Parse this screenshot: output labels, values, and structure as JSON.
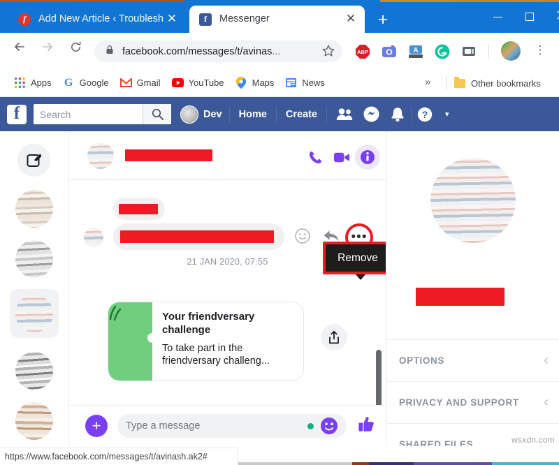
{
  "browser": {
    "tabs": [
      {
        "title": "Add New Article ‹ Troublesh",
        "favicon": "wordpress-icon",
        "active": false,
        "close_label": "✕"
      },
      {
        "title": "Messenger",
        "favicon": "facebook-icon",
        "active": true,
        "close_label": "✕"
      }
    ],
    "new_tab_label": "+",
    "window_controls": {
      "minimize": "−",
      "maximize": "□",
      "close": "✕"
    },
    "nav": {
      "back": "←",
      "forward": "→",
      "reload": "⟳"
    },
    "omnibox": {
      "url_visible": "facebook.com/messages/t/avinas",
      "url_ellipsis": "...",
      "lock_icon": "lock-icon",
      "star_icon": "bookmark-star-icon"
    },
    "extensions": [
      {
        "name": "adblock-plus-icon",
        "label": "ABP"
      },
      {
        "name": "screenshot-camera-icon",
        "label": ""
      },
      {
        "name": "translate-icon",
        "label": "A"
      },
      {
        "name": "grammarly-icon",
        "label": "G"
      },
      {
        "name": "clipboard-extension-icon",
        "label": ""
      }
    ],
    "profile_avatar": "user-avatar",
    "menu_icon": "chrome-menu-icon",
    "bookmarks": [
      {
        "label": "Apps",
        "icon": "apps-grid-icon"
      },
      {
        "label": "Google",
        "icon": "google-icon"
      },
      {
        "label": "Gmail",
        "icon": "gmail-icon"
      },
      {
        "label": "YouTube",
        "icon": "youtube-icon"
      },
      {
        "label": "Maps",
        "icon": "maps-pin-icon"
      },
      {
        "label": "News",
        "icon": "google-news-icon"
      }
    ],
    "bookmarks_overflow": "»",
    "other_bookmarks": "Other bookmarks",
    "status_url": "https://www.facebook.com/messages/t/avinash.ak2#"
  },
  "fb_header": {
    "logo": "f",
    "search_placeholder": "Search",
    "search_icon": "search-icon",
    "user_name": "Dev",
    "links": [
      {
        "label": "Home"
      },
      {
        "label": "Create"
      }
    ],
    "icons": [
      {
        "name": "friend-requests-icon"
      },
      {
        "name": "messenger-icon"
      },
      {
        "name": "notifications-bell-icon"
      },
      {
        "name": "help-question-icon"
      }
    ],
    "caret": "▾"
  },
  "messenger": {
    "rail": {
      "compose_icon": "compose-new-message-icon",
      "threads": [
        {
          "name": "thread-avatar-1",
          "selected": false
        },
        {
          "name": "thread-avatar-2",
          "selected": false
        },
        {
          "name": "thread-avatar-3",
          "selected": true
        },
        {
          "name": "thread-avatar-4",
          "selected": false
        },
        {
          "name": "thread-avatar-5",
          "selected": false
        }
      ]
    },
    "conversation": {
      "header": {
        "avatar": "contact-avatar",
        "name_redacted": true,
        "actions": [
          {
            "name": "voice-call-icon"
          },
          {
            "name": "video-call-icon"
          },
          {
            "name": "conversation-info-icon"
          }
        ]
      },
      "messages": [
        {
          "type": "text",
          "redacted": true,
          "size": "small"
        },
        {
          "type": "text",
          "redacted": true,
          "size": "large"
        }
      ],
      "hover_actions": [
        {
          "name": "react-emoji-icon"
        },
        {
          "name": "reply-arrow-icon"
        },
        {
          "name": "more-actions-icon",
          "highlighted": true
        }
      ],
      "tooltip": {
        "label": "Remove",
        "highlighted": true
      },
      "timestamp": "21 JAN 2020, 07:55",
      "card": {
        "title": "Your friendversary challenge",
        "subtitle": "To take part in the friendversary challeng...",
        "image": "friendversary-green-illustration",
        "share_icon": "share-icon"
      },
      "composer": {
        "plus_icon": "add-attachment-icon",
        "placeholder": "Type a message",
        "emoji_icon": "emoji-picker-icon",
        "like_icon": "thumbs-up-icon"
      }
    },
    "info_panel": {
      "avatar": "contact-profile-photo",
      "name_redacted": true,
      "sections": [
        {
          "label": "OPTIONS",
          "chevron": "‹",
          "expanded": false
        },
        {
          "label": "PRIVACY AND SUPPORT",
          "chevron": "‹",
          "expanded": false
        },
        {
          "label": "SHARED FILES",
          "chevron": "⌄",
          "expanded": true
        }
      ]
    }
  },
  "watermark": "wsxdn.com",
  "colors": {
    "chrome_blue": "#1275d4",
    "fb_blue": "#3b5998",
    "messenger_purple": "#7b3ff2",
    "redaction_red": "#ed1c24",
    "highlight_red": "#ec1c24",
    "card_green": "#6fcf7e"
  }
}
